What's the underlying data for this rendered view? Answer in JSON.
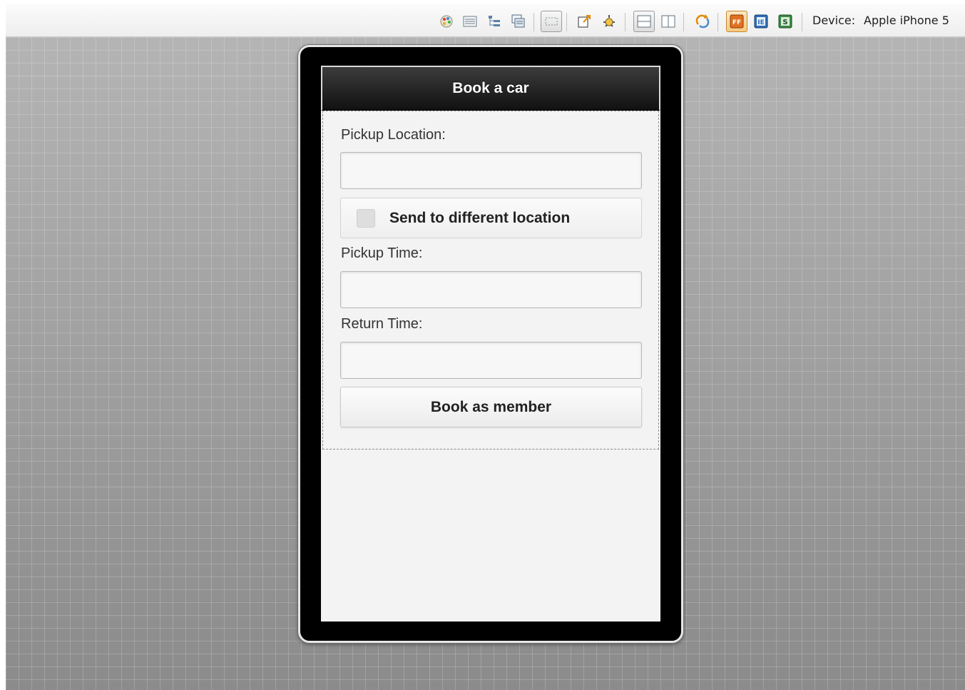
{
  "toolbar": {
    "icons": [
      "palette-icon",
      "list-icon",
      "tree-icon",
      "layers-icon",
      "selection-icon",
      "export-icon",
      "debug-icon",
      "split-horizontal-icon",
      "split-vertical-icon",
      "refresh-icon",
      "firefox-render-icon",
      "ie-render-icon",
      "safari-render-icon"
    ],
    "device_label": "Device:",
    "device_value": "Apple iPhone 5",
    "ff_label": "FF",
    "ie_label": "IE",
    "s_label": "S"
  },
  "app": {
    "header_title": "Book a car",
    "pickup_location_label": "Pickup Location:",
    "pickup_location_value": "",
    "send_different_label": "Send to different location",
    "send_different_checked": false,
    "pickup_time_label": "Pickup Time:",
    "pickup_time_value": "",
    "return_time_label": "Return Time:",
    "return_time_value": "",
    "book_button_label": "Book as member"
  }
}
